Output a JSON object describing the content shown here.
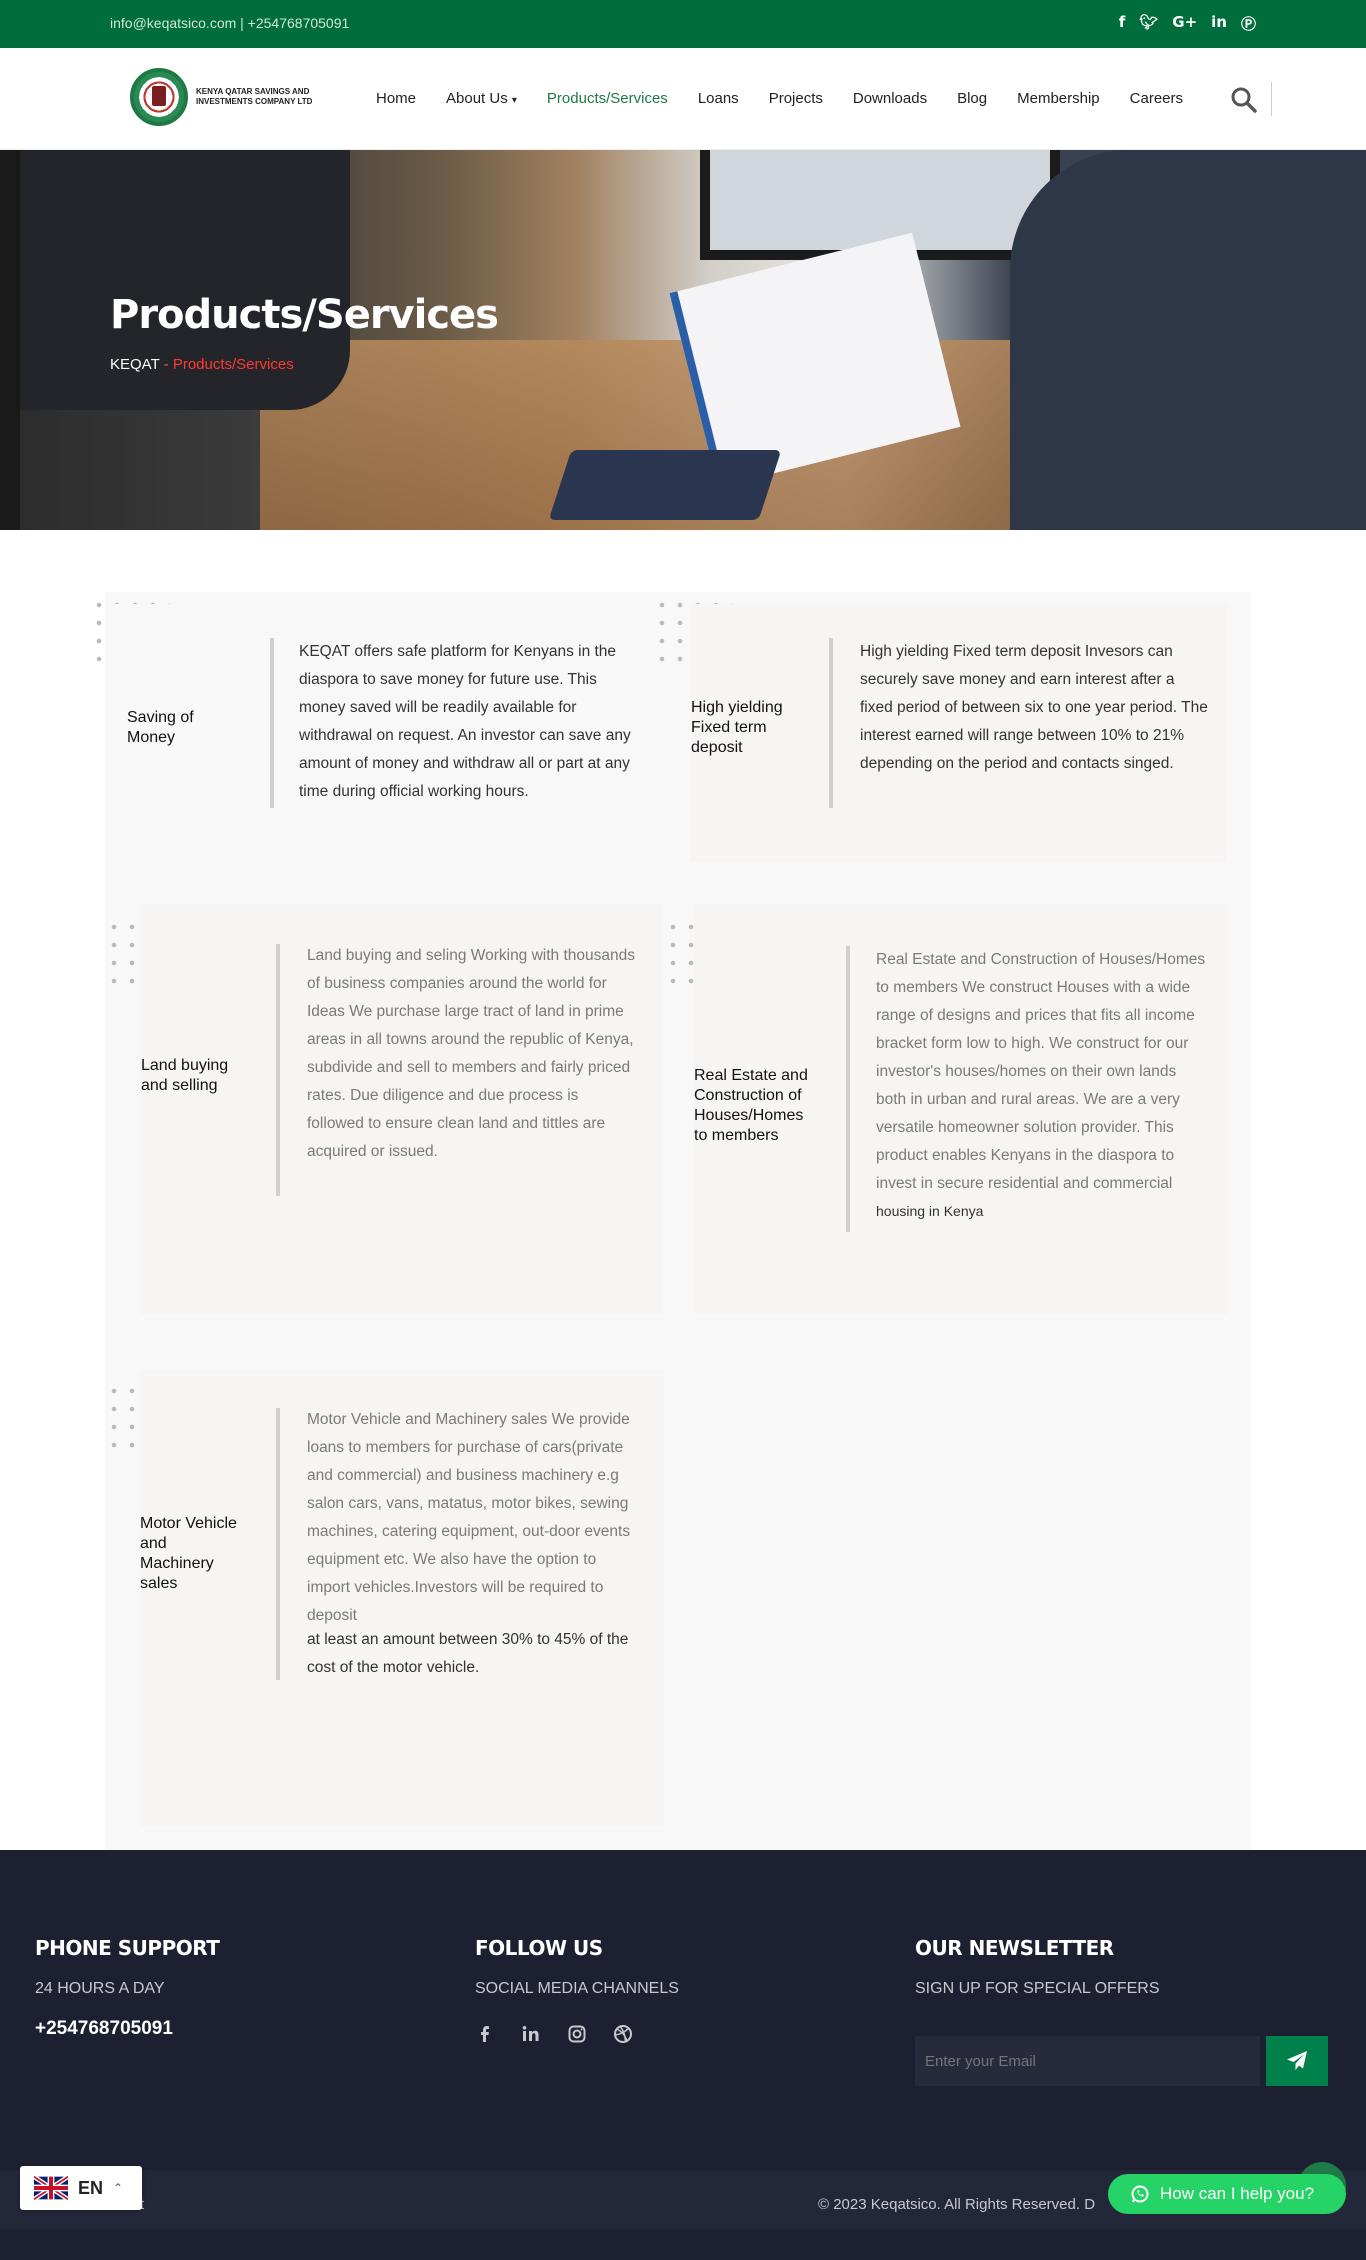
{
  "topbar": {
    "contact": "info@keqatsico.com | +254768705091",
    "social_icons": [
      "facebook-icon",
      "twitter-icon",
      "google-plus-icon",
      "linkedin-icon",
      "pinterest-icon"
    ]
  },
  "header": {
    "logo_text": "KENYA QATAR SAVINGS AND INVESTMENTS COMPANY LTD",
    "nav": [
      {
        "label": "Home"
      },
      {
        "label": "About Us"
      },
      {
        "label": "Products/Services"
      },
      {
        "label": "Loans"
      },
      {
        "label": "Projects"
      },
      {
        "label": "Downloads"
      },
      {
        "label": "Blog"
      },
      {
        "label": "Membership"
      },
      {
        "label": "Careers"
      }
    ],
    "active_nav": "Products/Services"
  },
  "hero": {
    "title": "Products/Services",
    "breadcrumb_home": "KEQAT",
    "breadcrumb_sep": " - ",
    "breadcrumb_current": "Products/Services"
  },
  "services": [
    {
      "title": "Saving of Money",
      "text": "KEQAT offers safe platform for Kenyans in the diaspora to save money for future use. This money saved will be readily available for withdrawal on request. An investor can save any amount of money and withdraw all or part at any time during official working hours."
    },
    {
      "title": "High yielding Fixed term deposit",
      "text": "High yielding Fixed term deposit Invesors can securely save money and earn interest after a fixed period of between six to one year period. The interest earned will range between 10% to 21% depending on the period and contacts singed."
    },
    {
      "title": "Land buying and selling",
      "text": "Land buying and seling Working with thousands of business companies around the world for Ideas We purchase large tract of land in prime areas in all towns around the republic of Kenya, subdivide and sell to members and fairly priced rates. Due diligence and due process is followed to ensure clean land and tittles are acquired or issued."
    },
    {
      "title": "Real Estate and Construction of Houses/Homes to members",
      "text": "Real Estate and Construction of Houses/Homes to members We construct Houses with a wide range of designs and prices that fits all income bracket form low to high. We construct for our investor's houses/homes on their own lands both in urban and rural areas. We are a very versatile homeowner solution provider. This product enables Kenyans in the diaspora to invest in secure residential and commercial",
      "overflow_text": "housing in Kenya"
    },
    {
      "title": "Motor Vehicle and Machinery sales",
      "text_light": "Motor Vehicle and Machinery sales We provide loans to members for purchase of cars(private and commercial) and business machinery e.g salon cars, vans, matatus, motor bikes, sewing machines, catering equipment, out-door events equipment etc. We also have the option to import vehicles.Investors will be required to deposit",
      "text_dark": "at least an amount between 30% to 45% of the cost of the motor vehicle."
    }
  ],
  "footer": {
    "phone_heading": "PHONE SUPPORT",
    "phone_sub": "24 HOURS A DAY",
    "phone_number": "+254768705091",
    "follow_heading": "FOLLOW US",
    "follow_sub": "SOCIAL MEDIA CHANNELS",
    "follow_icons": [
      "facebook-icon",
      "linkedin-icon",
      "instagram-icon",
      "dribbble-icon"
    ],
    "newsletter_heading": "OUR NEWSLETTER",
    "newsletter_sub": "SIGN UP FOR SPECIAL OFFERS",
    "email_placeholder": "Enter your Email",
    "contact_link": "act",
    "copyright": "© 2023 Keqatsico. All Rights Reserved. D"
  },
  "widgets": {
    "language_code": "EN",
    "help_label": "How can I help you?"
  },
  "colors": {
    "brand_green": "#006e3c",
    "accent_red": "#ff3b2f",
    "footer_bg": "#1d2030",
    "whatsapp_green": "#25d366"
  }
}
